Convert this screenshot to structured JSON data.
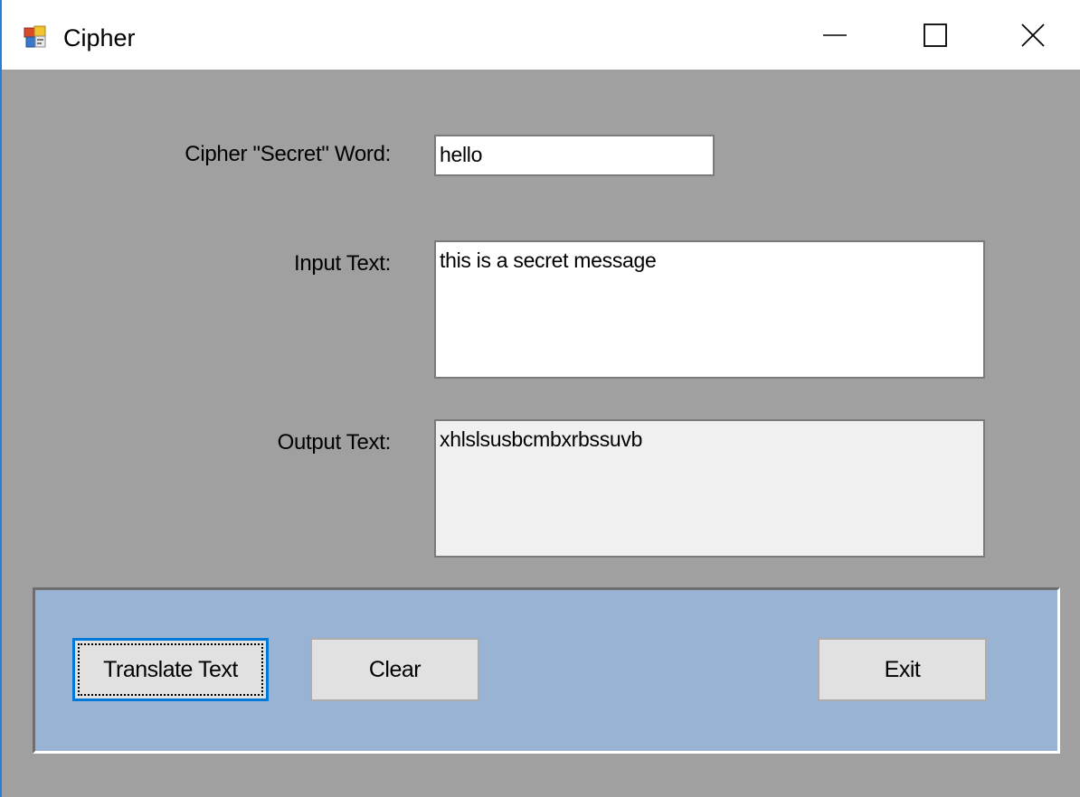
{
  "window": {
    "title": "Cipher",
    "icon": "winforms-app-icon",
    "controls": [
      "minimize-icon",
      "maximize-icon",
      "close-icon"
    ]
  },
  "form": {
    "secret_word_label": "Cipher \"Secret\" Word:",
    "secret_word_value": "hello",
    "input_text_label": "Input Text:",
    "input_text_value": "this is a secret message",
    "output_text_label": "Output Text:",
    "output_text_value": "xhlslsusbcmbxrbssuvb"
  },
  "buttons": {
    "translate": "Translate Text",
    "clear": "Clear",
    "exit": "Exit"
  },
  "colors": {
    "form_background": "#a0a0a0",
    "button_panel": "#98b3d3",
    "focus_border": "#0078d7",
    "readonly_field": "#f0f0f0"
  }
}
